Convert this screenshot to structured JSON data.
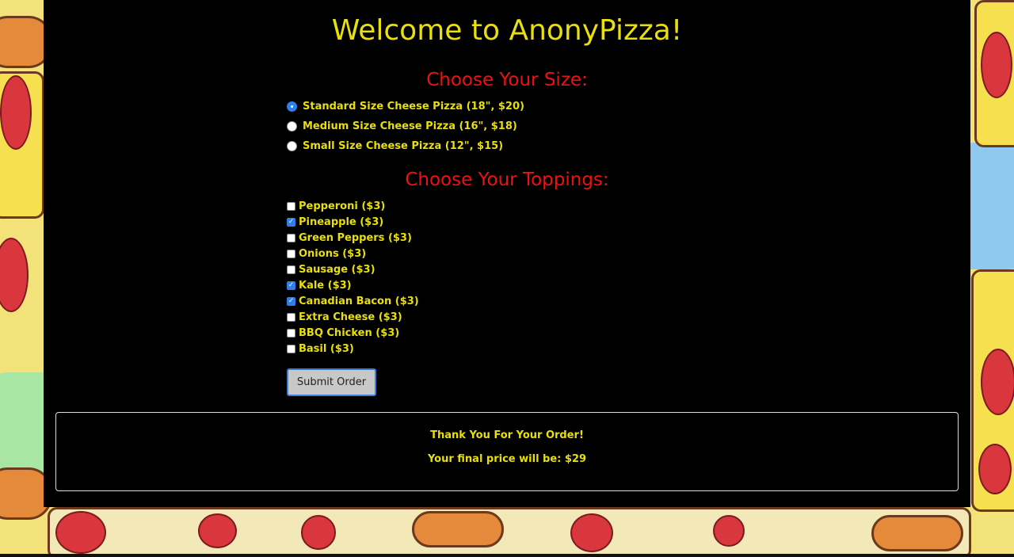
{
  "page": {
    "title": "Welcome to AnonyPizza!"
  },
  "size_section": {
    "heading": "Choose Your Size:",
    "options": [
      {
        "label": "Standard Size Cheese Pizza (18\", $20)",
        "selected": true
      },
      {
        "label": "Medium Size Cheese Pizza (16\", $18)",
        "selected": false
      },
      {
        "label": "Small Size Cheese Pizza (12\", $15)",
        "selected": false
      }
    ]
  },
  "toppings_section": {
    "heading": "Choose Your Toppings:",
    "items": [
      {
        "label": "Pepperoni ($3)",
        "checked": false
      },
      {
        "label": "Pineapple ($3)",
        "checked": true
      },
      {
        "label": "Green Peppers ($3)",
        "checked": false
      },
      {
        "label": "Onions ($3)",
        "checked": false
      },
      {
        "label": "Sausage ($3)",
        "checked": false
      },
      {
        "label": "Kale ($3)",
        "checked": true
      },
      {
        "label": "Canadian Bacon ($3)",
        "checked": true
      },
      {
        "label": "Extra Cheese ($3)",
        "checked": false
      },
      {
        "label": "BBQ Chicken ($3)",
        "checked": false
      },
      {
        "label": "Basil ($3)",
        "checked": false
      }
    ]
  },
  "submit": {
    "label": "Submit Order"
  },
  "result": {
    "thanks": "Thank You For Your Order!",
    "price": "Your final price will be: $29"
  },
  "colors": {
    "title": "#e8df0c",
    "heading": "#ee1111",
    "panel": "#000000",
    "accent": "#2f7fe8"
  }
}
